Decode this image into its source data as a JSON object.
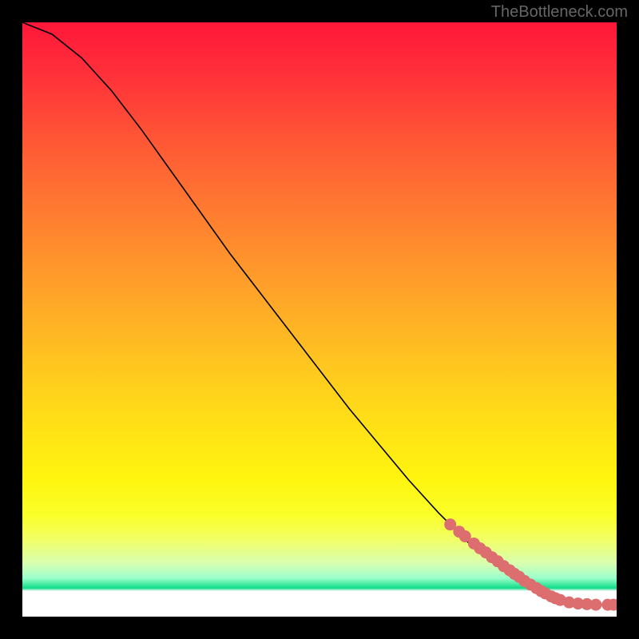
{
  "watermark": "TheBottleneck.com",
  "chart_data": {
    "type": "line",
    "title": "",
    "xlabel": "",
    "ylabel": "",
    "xlim": [
      0,
      100
    ],
    "ylim": [
      0,
      100
    ],
    "grid": false,
    "series": [
      {
        "name": "curve",
        "x": [
          0,
          5,
          10,
          15,
          20,
          25,
          30,
          35,
          40,
          45,
          50,
          55,
          60,
          65,
          70,
          75,
          80,
          85,
          88,
          90,
          92,
          95,
          98,
          100
        ],
        "values": [
          100,
          98,
          94,
          88.5,
          82,
          75,
          68,
          61,
          54.5,
          48,
          41.5,
          35,
          29,
          23,
          17.5,
          12.5,
          8.5,
          5,
          3.5,
          2.6,
          2.2,
          2.0,
          2.0,
          2.0
        ]
      }
    ],
    "markers": {
      "name": "highlighted-points",
      "color": "#dc6e6f",
      "x": [
        72,
        73.5,
        74.5,
        76,
        77,
        78,
        79,
        80,
        81,
        82,
        82.8,
        83.6,
        84.5,
        85.5,
        86.5,
        87.3,
        88,
        89,
        89.7,
        90.5,
        92,
        93.5,
        95,
        96.5,
        98.5,
        99.5
      ],
      "values": [
        15.5,
        14.3,
        13.5,
        12.3,
        11.5,
        10.8,
        10.0,
        9.3,
        8.5,
        7.8,
        7.2,
        6.7,
        6.0,
        5.4,
        4.8,
        4.3,
        3.9,
        3.4,
        3.1,
        2.8,
        2.4,
        2.2,
        2.1,
        2.0,
        2.0,
        2.0
      ]
    }
  }
}
